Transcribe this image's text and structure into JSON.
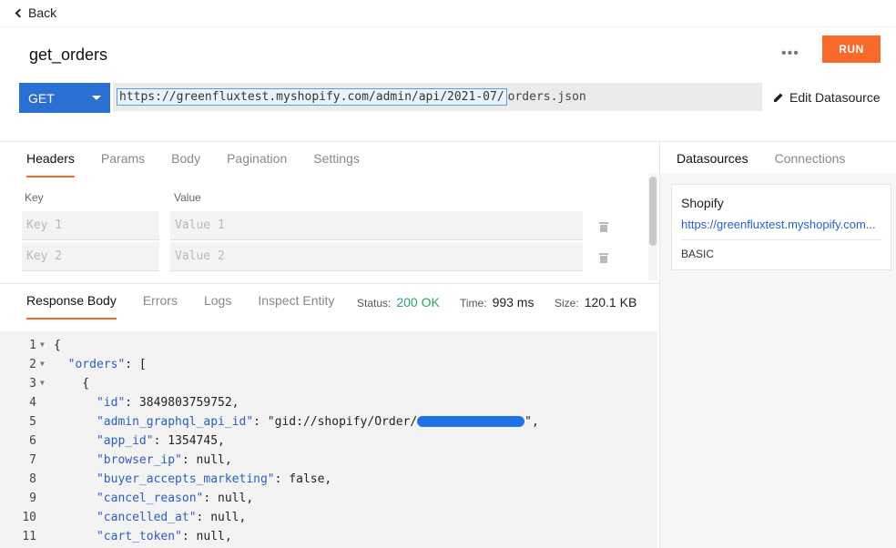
{
  "nav": {
    "back_label": "Back"
  },
  "api": {
    "name": "get_orders",
    "more_label": "•••",
    "run_label": "RUN",
    "method": "GET",
    "datasource_url": "https://greenfluxtest.myshopify.com/admin/api/2021-07/",
    "path": "orders.json",
    "edit_datasource_label": "Edit Datasource"
  },
  "request_tabs": [
    "Headers",
    "Params",
    "Body",
    "Pagination",
    "Settings"
  ],
  "headers": {
    "key_label": "Key",
    "value_label": "Value",
    "rows": [
      {
        "key_placeholder": "Key 1",
        "value_placeholder": "Value 1"
      },
      {
        "key_placeholder": "Key 2",
        "value_placeholder": "Value 2"
      }
    ]
  },
  "response_tabs": [
    "Response Body",
    "Errors",
    "Logs",
    "Inspect Entity"
  ],
  "response_meta": {
    "status_label": "Status:",
    "status_value": "200 OK",
    "time_label": "Time:",
    "time_value": "993 ms",
    "size_label": "Size:",
    "size_value": "120.1 KB"
  },
  "code_lines": [
    {
      "n": "1",
      "text": "{"
    },
    {
      "n": "2",
      "text": "  \"orders\": ["
    },
    {
      "n": "3",
      "text": "    {"
    },
    {
      "n": "4",
      "text": "      \"id\": 3849803759752,"
    },
    {
      "n": "5",
      "text": "      \"admin_graphql_api_id\": \"gid://shopify/Order/"
    },
    {
      "n": "6",
      "text": "      \"app_id\": 1354745,"
    },
    {
      "n": "7",
      "text": "      \"browser_ip\": null,"
    },
    {
      "n": "8",
      "text": "      \"buyer_accepts_marketing\": false,"
    },
    {
      "n": "9",
      "text": "      \"cancel_reason\": null,"
    },
    {
      "n": "10",
      "text": "      \"cancelled_at\": null,"
    },
    {
      "n": "11",
      "text": "      \"cart_token\": null,"
    }
  ],
  "side_tabs": [
    "Datasources",
    "Connections"
  ],
  "datasource_card": {
    "name": "Shopify",
    "url": "https://greenfluxtest.myshopify.com...",
    "auth": "BASIC"
  },
  "colors": {
    "accent": "#f86a2b",
    "method": "#2a6fd1",
    "status_ok": "#2ba56a",
    "json_key": "#2c5ec4"
  }
}
